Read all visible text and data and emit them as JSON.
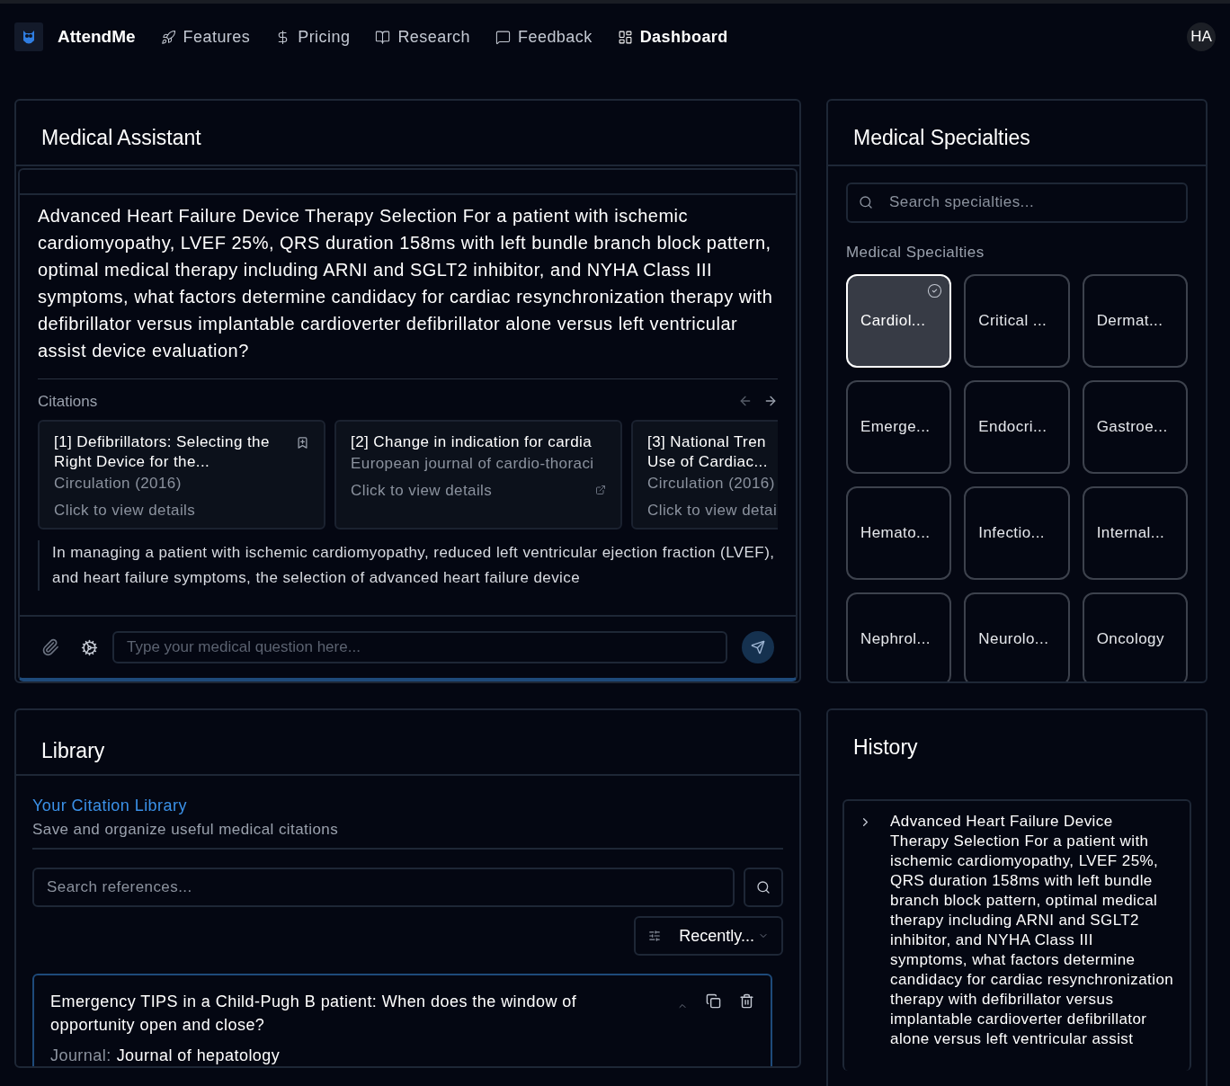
{
  "nav": {
    "brand": "AttendMe",
    "items": [
      {
        "label": "Features",
        "selected": false
      },
      {
        "label": "Pricing",
        "selected": false
      },
      {
        "label": "Research",
        "selected": false
      },
      {
        "label": "Feedback",
        "selected": false
      },
      {
        "label": "Dashboard",
        "selected": true
      }
    ],
    "avatar": "HA"
  },
  "assistant": {
    "title": "Medical Assistant",
    "question": "Advanced Heart Failure Device Therapy Selection For a patient with ischemic cardiomyopathy, LVEF 25%, QRS duration 158ms with left bundle branch block pattern, optimal medical therapy including ARNI and SGLT2 inhibitor, and NYHA Class III symptoms, what factors determine candidacy for cardiac resynchronization therapy with defibrillator versus implantable cardioverter defibrillator alone versus left ventricular assist device evaluation?",
    "citations_label": "Citations",
    "citations": [
      {
        "title": "[1] Defibrillators: Selecting the Right Device for the...",
        "source": "Circulation (2016)",
        "action": "Click to view details",
        "kind": "bookmark"
      },
      {
        "title": "[2] Change in indication for cardia",
        "source": "European journal of cardio-thoraci",
        "action": "Click to view details",
        "kind": "external"
      },
      {
        "title": "[3] National Tren Use of Cardiac...",
        "source": "Circulation (2016)",
        "action": "Click to view detai",
        "kind": "plain"
      }
    ],
    "answer": "In managing a patient with ischemic cardiomyopathy, reduced left ventricular ejection fraction (LVEF), and heart failure symptoms, the selection of advanced heart failure device",
    "input": {
      "placeholder": "Type your medical question here..."
    }
  },
  "specialties": {
    "title": "Medical Specialties",
    "search": {
      "placeholder": "Search specialties..."
    },
    "label": "Medical Specialties",
    "items": [
      {
        "label": "Cardiol...",
        "selected": true
      },
      {
        "label": "Critical ...",
        "selected": false
      },
      {
        "label": "Dermat...",
        "selected": false
      },
      {
        "label": "Emerge...",
        "selected": false
      },
      {
        "label": "Endocri...",
        "selected": false
      },
      {
        "label": "Gastroe...",
        "selected": false
      },
      {
        "label": "Hemato...",
        "selected": false
      },
      {
        "label": "Infectio...",
        "selected": false
      },
      {
        "label": "Internal...",
        "selected": false
      },
      {
        "label": "Nephrol...",
        "selected": false
      },
      {
        "label": "Neurolo...",
        "selected": false
      },
      {
        "label": "Oncology",
        "selected": false
      }
    ]
  },
  "library": {
    "title": "Library",
    "heading": "Your Citation Library",
    "subtitle": "Save and organize useful medical citations",
    "search": {
      "placeholder": "Search references..."
    },
    "sort": "Recently...",
    "items": [
      {
        "title": "Emergency TIPS in a Child-Pugh B patient: When does the window of opportunity open and close?",
        "journal_label": "Journal:",
        "journal": "Journal of hepatology",
        "expanded": true
      }
    ]
  },
  "history": {
    "title": "History",
    "items": [
      {
        "text": "Advanced Heart Failure Device Therapy Selection For a patient with ischemic cardiomyopathy, LVEF 25%, QRS duration 158ms with left bundle branch block pattern, optimal medical therapy including ARNI and SGLT2 inhibitor, and NYHA Class III symptoms, what factors determine candidacy for cardiac resynchronization therapy with defibrillator versus implantable cardioverter defibrillator alone versus left ventricular assist",
        "expanded": false
      }
    ]
  }
}
